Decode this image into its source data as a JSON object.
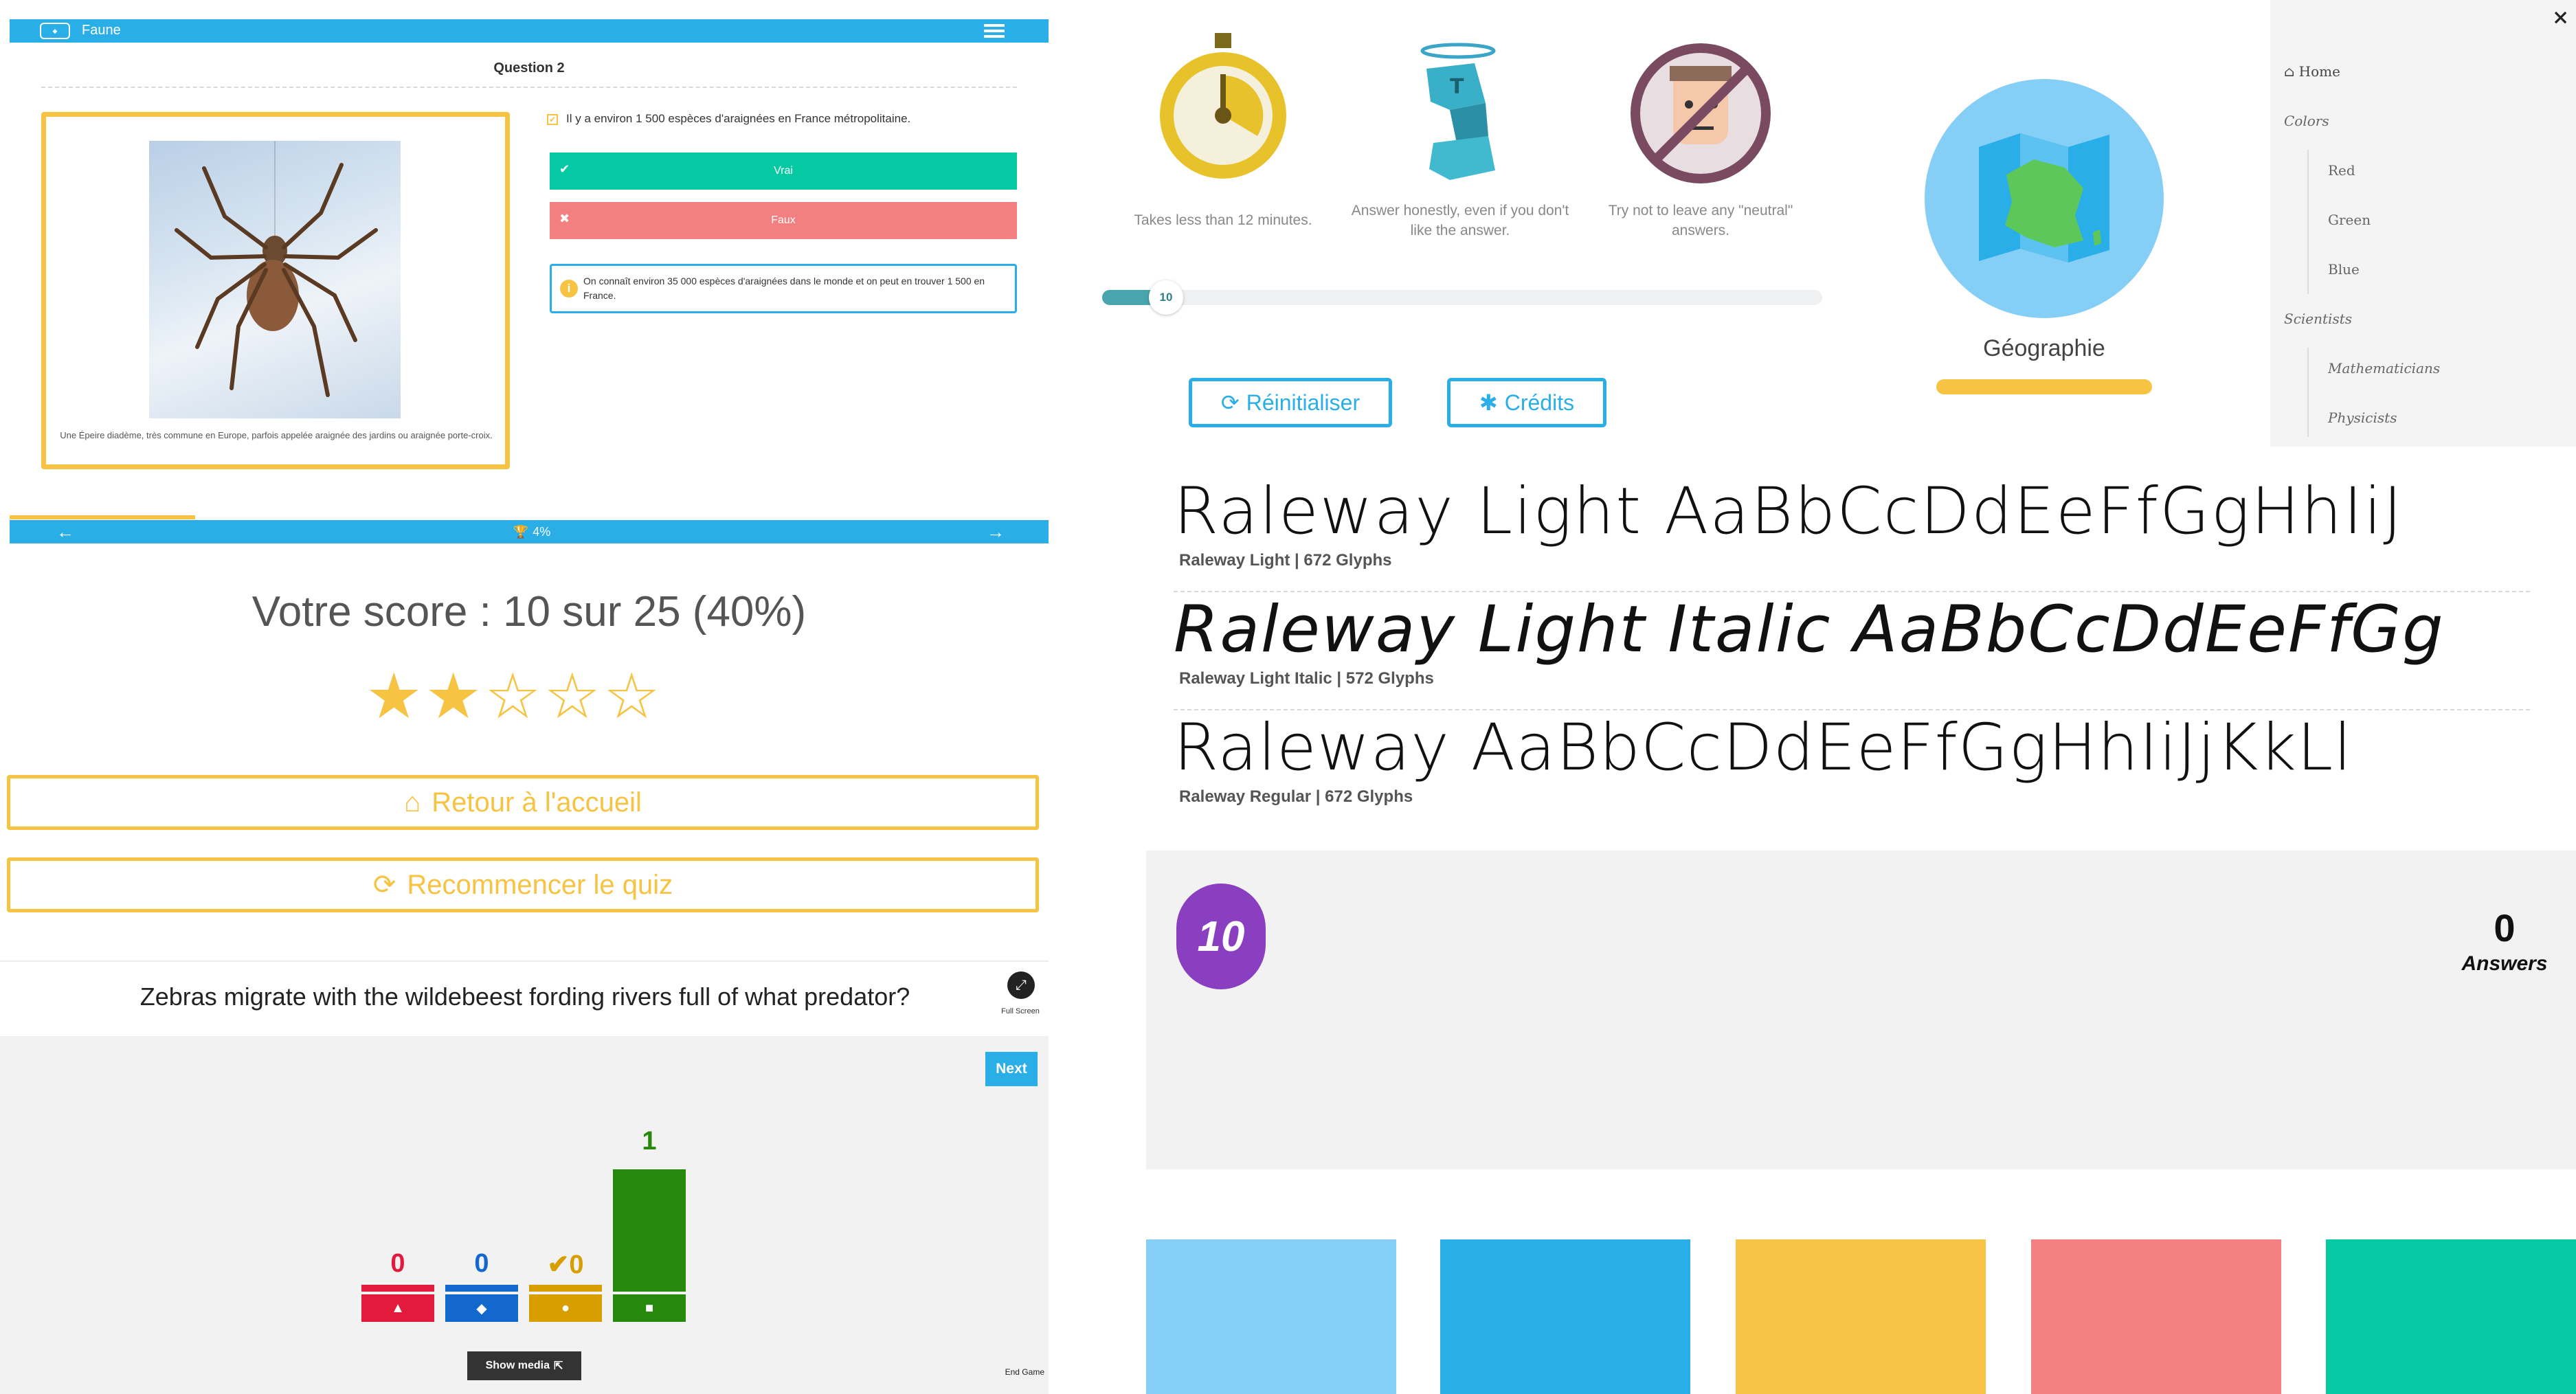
{
  "quiz": {
    "app_title": "Faune",
    "question_title": "Question 2",
    "statement": "Il y a environ 1 500 espèces d'araignées en France métropolitaine.",
    "true_label": "Vrai",
    "false_label": "Faux",
    "info_text": "On connaît environ 35 000 espèces d'araignées dans le monde et on peut en trouver 1 500 en France.",
    "caption": "Une Épeire diadème, très commune en Europe, parfois appelée araignée des jardins ou araignée porte-croix.",
    "progress_label": "4%",
    "progress_fraction": 0.04
  },
  "score": {
    "text": "Votre score : 10 sur 25 (40%)",
    "stars_filled": 2,
    "stars_total": 5,
    "home_label": "Retour à l'accueil",
    "restart_label": "Recommencer le quiz"
  },
  "poll": {
    "question": "Zebras migrate with the wildebeest fording rivers full of what predator?",
    "fullscreen_label": "Full Screen",
    "next_label": "Next",
    "show_media_label": "Show media",
    "end_game_label": "End Game",
    "bars": [
      {
        "count": "0",
        "color": "#e21b3c",
        "shape": "triangle"
      },
      {
        "count": "0",
        "color": "#1368ce",
        "shape": "diamond"
      },
      {
        "count": "✔0",
        "color": "#d89e00",
        "shape": "circle"
      },
      {
        "count": "1",
        "color": "#26890c",
        "shape": "square"
      }
    ]
  },
  "intro": {
    "tip1": "Takes less than 12 minutes.",
    "tip2": "Answer honestly, even if you don't like the answer.",
    "tip3": "Try not to leave any \"neutral\" answers.",
    "slider_value": "10",
    "reset_label": "Réinitialiser",
    "credits_label": "Crédits",
    "category_label": "Géographie"
  },
  "menu": {
    "close": "×",
    "items": [
      "Home",
      "Colors",
      "Red",
      "Green",
      "Blue",
      "Scientists",
      "Mathematicians",
      "Physicists"
    ]
  },
  "fonts": {
    "light_sample": "Raleway Light AaBbCcDdEeFfGgHhIiJ",
    "light_meta": "Raleway Light | 672 Glyphs",
    "italic_sample": "Raleway Light Italic AaBbCcDdEeFfGg",
    "italic_meta": "Raleway Light Italic | 572 Glyphs",
    "regular_sample": "Raleway AaBbCcDdEeFfGgHhIiJjKkLl",
    "regular_meta": "Raleway Regular | 672 Glyphs"
  },
  "counter": {
    "timer": "10",
    "answers_count": "0",
    "answers_label": "Answers"
  },
  "palette": [
    "#85cff6",
    "#2aaee8",
    "#f8c447",
    "#f38080",
    "#04c9a3"
  ]
}
